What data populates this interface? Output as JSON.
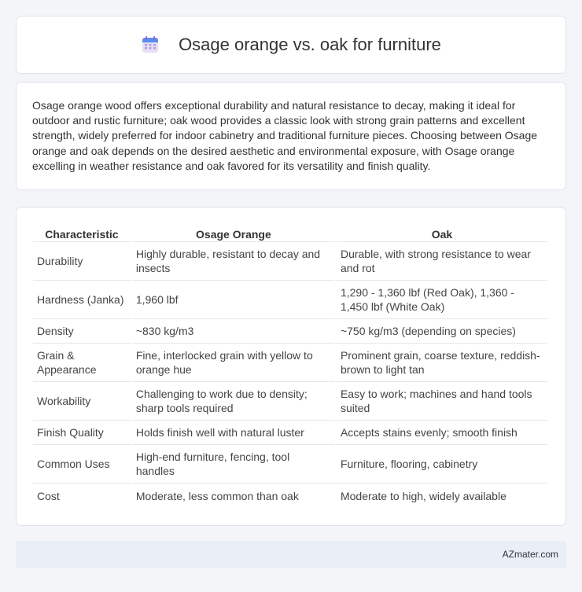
{
  "header": {
    "icon": "calendar-icon",
    "title": "Osage orange vs. oak for furniture"
  },
  "intro": {
    "text": "Osage orange wood offers exceptional durability and natural resistance to decay, making it ideal for outdoor and rustic furniture; oak wood provides a classic look with strong grain patterns and excellent strength, widely preferred for indoor cabinetry and traditional furniture pieces. Choosing between Osage orange and oak depends on the desired aesthetic and environmental exposure, with Osage orange excelling in weather resistance and oak favored for its versatility and finish quality."
  },
  "table": {
    "headers": [
      "Characteristic",
      "Osage Orange",
      "Oak"
    ],
    "rows": [
      [
        "Durability",
        "Highly durable, resistant to decay and insects",
        "Durable, with strong resistance to wear and rot"
      ],
      [
        "Hardness (Janka)",
        "1,960 lbf",
        "1,290 - 1,360 lbf (Red Oak), 1,360 - 1,450 lbf (White Oak)"
      ],
      [
        "Density",
        "~830 kg/m3",
        "~750 kg/m3 (depending on species)"
      ],
      [
        "Grain & Appearance",
        "Fine, interlocked grain with yellow to orange hue",
        "Prominent grain, coarse texture, reddish-brown to light tan"
      ],
      [
        "Workability",
        "Challenging to work due to density; sharp tools required",
        "Easy to work; machines and hand tools suited"
      ],
      [
        "Finish Quality",
        "Holds finish well with natural luster",
        "Accepts stains evenly; smooth finish"
      ],
      [
        "Common Uses",
        "High-end furniture, fencing, tool handles",
        "Furniture, flooring, cabinetry"
      ],
      [
        "Cost",
        "Moderate, less common than oak",
        "Moderate to high, widely available"
      ]
    ]
  },
  "footer": {
    "site": "AZmater.com"
  }
}
